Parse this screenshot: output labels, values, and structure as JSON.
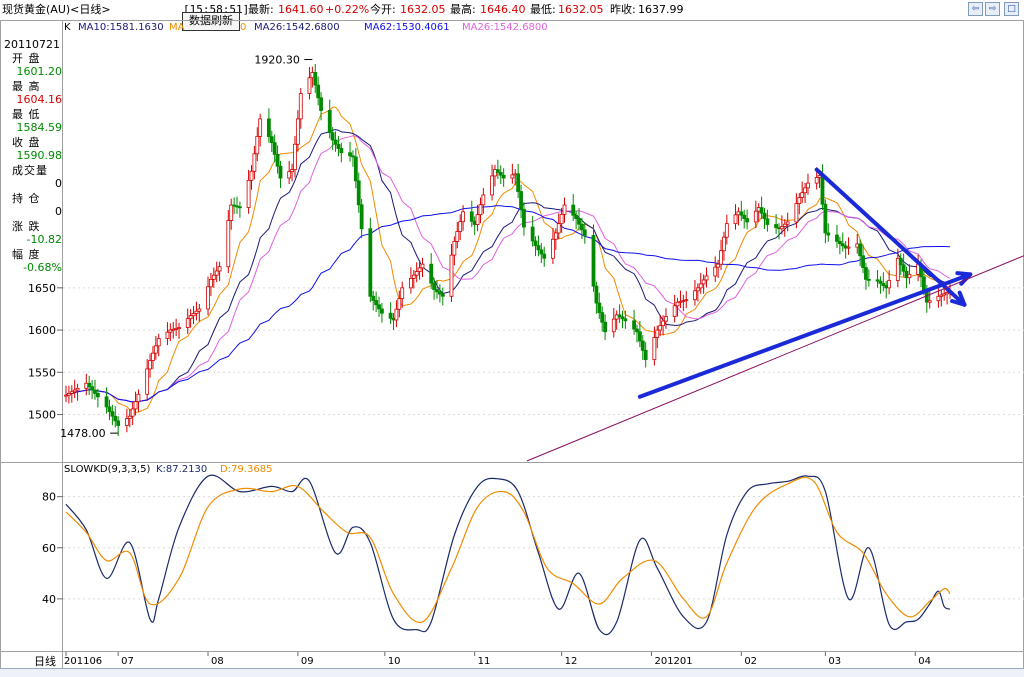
{
  "header": {
    "instrument": "现货黄金(AU)<日线>",
    "time": "[15:58:51]",
    "refresh_label": "数据刷新",
    "latest_label": "最新:",
    "latest_value": "1641.60",
    "change_value": "+0.22%",
    "open_label": "今开:",
    "open_value": "1632.05",
    "high_label": "最高:",
    "high_value": "1646.40",
    "low_label": "最低:",
    "low_value": "1632.05",
    "prev_label": "昨收:",
    "prev_value": "1637.99"
  },
  "ma_legend": {
    "prefix": "K",
    "ma10": "MA10:1581.1630",
    "ma20_partial": "MA",
    "ma20_tail": "0",
    "ma26": "MA26:1542.6800",
    "ma62": "MA62:1530.4061",
    "ma26b": "MA26:1542.6800"
  },
  "info_panel": {
    "date": "20110721",
    "open_label": "开 盘",
    "open": "1601.20",
    "high_label": "最 高",
    "high": "1604.16",
    "low_label": "最 低",
    "low": "1584.59",
    "close_label": "收 盘",
    "close": "1590.98",
    "volume_label": "成交量",
    "volume": "0",
    "position_label": "持 仓",
    "position": "0",
    "change_label": "涨 跌",
    "change": "-10.82",
    "amplitude_label": "幅 度",
    "amplitude": "-0.68%"
  },
  "kd_legend": {
    "name": "SLOWKD(9,3,3,5)",
    "k": "K:87.2130",
    "d": "D:79.3685"
  },
  "axis": {
    "bottom_label": "日线"
  },
  "colors": {
    "up": "#d40000",
    "down": "#008a00",
    "ma10": "#f08c00",
    "ma26": "#1a1a7a",
    "ma62": "#1010ee",
    "ma26b": "#e060e0",
    "trendline": "#1a2ad8",
    "k_line": "#1a2a6a",
    "d_line": "#f08c00"
  },
  "chart_data": [
    {
      "type": "candlestick",
      "annotations": [
        {
          "label": "1920.30",
          "date": "2011-09-06"
        },
        {
          "label": "1478.00",
          "date": "2011-07-01"
        }
      ],
      "ylim": [
        1445,
        1960
      ],
      "ytick_labels": [
        "1500",
        "1550",
        "1600",
        "1650"
      ],
      "x_tick_labels": [
        "201106",
        "07",
        "08",
        "09",
        "10",
        "11",
        "12",
        "201201",
        "02",
        "03",
        "04"
      ],
      "x_start": "2011-06-13",
      "x_end": "2012-04-13",
      "anchors": [
        [
          "2011-06-13",
          1523
        ],
        [
          "2011-06-16",
          1529
        ],
        [
          "2011-06-20",
          1537
        ],
        [
          "2011-06-23",
          1525
        ],
        [
          "2011-06-27",
          1509
        ],
        [
          "2011-07-01",
          1487
        ],
        [
          "2011-07-05",
          1498
        ],
        [
          "2011-07-08",
          1524
        ],
        [
          "2011-07-12",
          1564
        ],
        [
          "2011-07-15",
          1590
        ],
        [
          "2011-07-19",
          1600
        ],
        [
          "2011-07-22",
          1603
        ],
        [
          "2011-07-26",
          1617
        ],
        [
          "2011-07-29",
          1625
        ],
        [
          "2011-08-02",
          1660
        ],
        [
          "2011-08-05",
          1675
        ],
        [
          "2011-08-09",
          1748
        ],
        [
          "2011-08-12",
          1745
        ],
        [
          "2011-08-16",
          1788
        ],
        [
          "2011-08-19",
          1850
        ],
        [
          "2011-08-23",
          1822
        ],
        [
          "2011-08-26",
          1780
        ],
        [
          "2011-08-30",
          1790
        ],
        [
          "2011-09-02",
          1880
        ],
        [
          "2011-09-06",
          1905
        ],
        [
          "2011-09-09",
          1860
        ],
        [
          "2011-09-13",
          1825
        ],
        [
          "2011-09-16",
          1810
        ],
        [
          "2011-09-20",
          1805
        ],
        [
          "2011-09-23",
          1720
        ],
        [
          "2011-09-26",
          1640
        ],
        [
          "2011-09-30",
          1620
        ],
        [
          "2011-10-04",
          1612
        ],
        [
          "2011-10-07",
          1650
        ],
        [
          "2011-10-11",
          1665
        ],
        [
          "2011-10-14",
          1678
        ],
        [
          "2011-10-18",
          1648
        ],
        [
          "2011-10-21",
          1640
        ],
        [
          "2011-10-25",
          1705
        ],
        [
          "2011-10-28",
          1740
        ],
        [
          "2011-11-01",
          1725
        ],
        [
          "2011-11-04",
          1760
        ],
        [
          "2011-11-08",
          1790
        ],
        [
          "2011-11-11",
          1780
        ],
        [
          "2011-11-15",
          1785
        ],
        [
          "2011-11-18",
          1722
        ],
        [
          "2011-11-22",
          1700
        ],
        [
          "2011-11-25",
          1685
        ],
        [
          "2011-11-29",
          1715
        ],
        [
          "2011-12-02",
          1748
        ],
        [
          "2011-12-06",
          1732
        ],
        [
          "2011-12-09",
          1712
        ],
        [
          "2011-12-13",
          1632
        ],
        [
          "2011-12-16",
          1598
        ],
        [
          "2011-12-20",
          1618
        ],
        [
          "2011-12-23",
          1611
        ],
        [
          "2011-12-27",
          1598
        ],
        [
          "2011-12-30",
          1565
        ],
        [
          "2012-01-03",
          1600
        ],
        [
          "2012-01-06",
          1616
        ],
        [
          "2012-01-10",
          1633
        ],
        [
          "2012-01-13",
          1636
        ],
        [
          "2012-01-17",
          1650
        ],
        [
          "2012-01-20",
          1664
        ],
        [
          "2012-01-24",
          1678
        ],
        [
          "2012-01-27",
          1726
        ],
        [
          "2012-01-31",
          1740
        ],
        [
          "2012-02-03",
          1728
        ],
        [
          "2012-02-07",
          1745
        ],
        [
          "2012-02-10",
          1725
        ],
        [
          "2012-02-14",
          1720
        ],
        [
          "2012-02-17",
          1728
        ],
        [
          "2012-02-21",
          1757
        ],
        [
          "2012-02-24",
          1774
        ],
        [
          "2012-02-28",
          1783
        ],
        [
          "2012-03-01",
          1715
        ],
        [
          "2012-03-05",
          1705
        ],
        [
          "2012-03-08",
          1697
        ],
        [
          "2012-03-12",
          1702
        ],
        [
          "2012-03-15",
          1660
        ],
        [
          "2012-03-19",
          1658
        ],
        [
          "2012-03-22",
          1650
        ],
        [
          "2012-03-26",
          1685
        ],
        [
          "2012-03-29",
          1662
        ],
        [
          "2012-04-02",
          1678
        ],
        [
          "2012-04-05",
          1633
        ],
        [
          "2012-04-09",
          1640
        ],
        [
          "2012-04-13",
          1646
        ]
      ],
      "trendlines": [
        {
          "from": [
            "2012-02-27",
            1790
          ],
          "to": [
            "2012-04-18",
            1630
          ]
        },
        {
          "from": [
            "2011-12-28",
            1521
          ],
          "to": [
            "2012-04-20",
            1666
          ]
        },
        {
          "from": [
            "2011-11-19",
            1445
          ],
          "to": [
            "2012-04-30",
            1676
          ]
        }
      ]
    },
    {
      "type": "line",
      "title": "SLOWKD(9,3,3,5)",
      "ylim": [
        20,
        92
      ],
      "ytick_labels": [
        "40",
        "60",
        "80"
      ],
      "series": [
        {
          "name": "K",
          "values": [
            [
              "2011-06-13",
              77
            ],
            [
              "2011-06-20",
              67
            ],
            [
              "2011-06-27",
              48
            ],
            [
              "2011-07-05",
              62
            ],
            [
              "2011-07-12",
              32
            ],
            [
              "2011-07-15",
              40
            ],
            [
              "2011-07-22",
              68
            ],
            [
              "2011-08-01",
              88
            ],
            [
              "2011-08-12",
              82
            ],
            [
              "2011-08-23",
              84
            ],
            [
              "2011-08-30",
              82
            ],
            [
              "2011-09-05",
              86
            ],
            [
              "2011-09-14",
              58
            ],
            [
              "2011-09-20",
              68
            ],
            [
              "2011-09-26",
              62
            ],
            [
              "2011-10-04",
              32
            ],
            [
              "2011-10-12",
              28
            ],
            [
              "2011-10-17",
              31
            ],
            [
              "2011-10-25",
              65
            ],
            [
              "2011-11-02",
              84
            ],
            [
              "2011-11-09",
              87
            ],
            [
              "2011-11-16",
              82
            ],
            [
              "2011-11-23",
              58
            ],
            [
              "2011-11-30",
              36
            ],
            [
              "2011-12-07",
              50
            ],
            [
              "2011-12-14",
              28
            ],
            [
              "2011-12-20",
              31
            ],
            [
              "2011-12-28",
              63
            ],
            [
              "2012-01-03",
              52
            ],
            [
              "2012-01-12",
              33
            ],
            [
              "2012-01-20",
              31
            ],
            [
              "2012-01-27",
              65
            ],
            [
              "2012-02-03",
              82
            ],
            [
              "2012-02-10",
              85
            ],
            [
              "2012-02-17",
              86
            ],
            [
              "2012-02-24",
              88
            ],
            [
              "2012-03-01",
              82
            ],
            [
              "2012-03-09",
              40
            ],
            [
              "2012-03-16",
              60
            ],
            [
              "2012-03-23",
              30
            ],
            [
              "2012-03-29",
              31
            ],
            [
              "2012-04-02",
              32
            ],
            [
              "2012-04-06",
              38
            ],
            [
              "2012-04-09",
              43
            ],
            [
              "2012-04-11",
              37
            ],
            [
              "2012-04-13",
              36
            ]
          ]
        },
        {
          "name": "D",
          "values": [
            [
              "2011-06-13",
              74
            ],
            [
              "2011-06-20",
              66
            ],
            [
              "2011-06-27",
              55
            ],
            [
              "2011-07-05",
              58
            ],
            [
              "2011-07-12",
              38
            ],
            [
              "2011-07-22",
              48
            ],
            [
              "2011-08-01",
              76
            ],
            [
              "2011-08-12",
              83
            ],
            [
              "2011-08-23",
              82
            ],
            [
              "2011-09-01",
              84
            ],
            [
              "2011-09-10",
              74
            ],
            [
              "2011-09-18",
              66
            ],
            [
              "2011-09-26",
              64
            ],
            [
              "2011-10-04",
              42
            ],
            [
              "2011-10-14",
              31
            ],
            [
              "2011-10-24",
              52
            ],
            [
              "2011-11-02",
              76
            ],
            [
              "2011-11-11",
              82
            ],
            [
              "2011-11-18",
              74
            ],
            [
              "2011-11-26",
              52
            ],
            [
              "2011-12-05",
              46
            ],
            [
              "2011-12-14",
              38
            ],
            [
              "2011-12-22",
              48
            ],
            [
              "2012-01-02",
              55
            ],
            [
              "2012-01-12",
              40
            ],
            [
              "2012-01-20",
              33
            ],
            [
              "2012-01-27",
              54
            ],
            [
              "2012-02-06",
              76
            ],
            [
              "2012-02-17",
              85
            ],
            [
              "2012-02-26",
              86
            ],
            [
              "2012-03-05",
              66
            ],
            [
              "2012-03-14",
              58
            ],
            [
              "2012-03-22",
              42
            ],
            [
              "2012-03-30",
              33
            ],
            [
              "2012-04-06",
              39
            ],
            [
              "2012-04-11",
              44
            ],
            [
              "2012-04-13",
              42
            ]
          ]
        }
      ]
    }
  ]
}
